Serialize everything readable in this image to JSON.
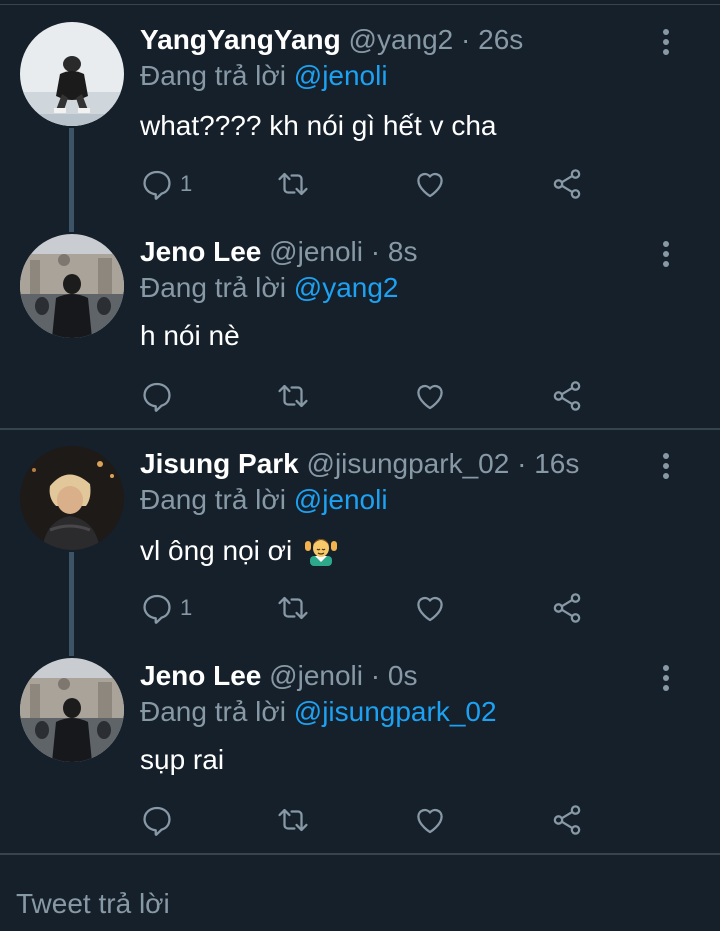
{
  "colors": {
    "background": "#15202b",
    "text_primary": "#ffffff",
    "text_secondary": "#8899a6",
    "mention": "#1da1f2",
    "divider": "#38444d",
    "thread_line": "#3d5466"
  },
  "tweets": [
    {
      "name": "YangYangYang",
      "handle": "@yang2",
      "separator": "·",
      "time": "26s",
      "reply_prefix": "Đang trả lời",
      "reply_to": "@jenoli",
      "text": "what???? kh nói gì hết v cha",
      "reply_count": "1",
      "avatar": "avatar-yang2"
    },
    {
      "name": "Jeno Lee",
      "handle": "@jenoli",
      "separator": "·",
      "time": "8s",
      "reply_prefix": "Đang trả lời",
      "reply_to": "@yang2",
      "text": "h nói nè",
      "reply_count": "",
      "avatar": "avatar-jenoli"
    },
    {
      "name": "Jisung Park",
      "handle": "@jisungpark_02",
      "separator": "·",
      "time": "16s",
      "reply_prefix": "Đang trả lời",
      "reply_to": "@jenoli",
      "text": "vl ông nọi ơi",
      "emoji": "person-getting-massage-emoji",
      "reply_count": "1",
      "avatar": "avatar-jisungpark"
    },
    {
      "name": "Jeno Lee",
      "handle": "@jenoli",
      "separator": "·",
      "time": "0s",
      "reply_prefix": "Đang trả lời",
      "reply_to": "@jisungpark_02",
      "text": "sụp rai",
      "reply_count": "",
      "avatar": "avatar-jenoli"
    }
  ],
  "icons": {
    "reply": "reply-bubble-icon",
    "retweet": "retweet-icon",
    "like": "heart-icon",
    "share": "share-icon",
    "more": "more-vertical-icon"
  },
  "composer": {
    "placeholder": "Tweet trả lời"
  }
}
